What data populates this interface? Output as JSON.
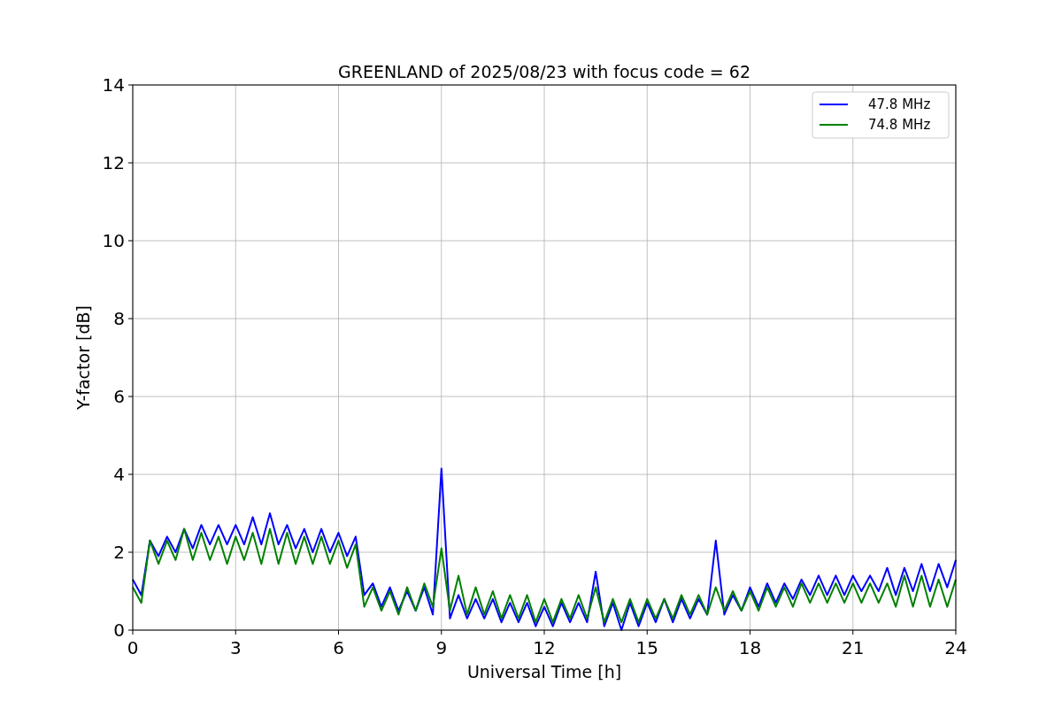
{
  "figure": {
    "chart_data": {
      "type": "line",
      "title": "GREENLAND of 2025/08/23 with focus code = 62",
      "xlabel": "Universal Time [h]",
      "ylabel": "Y-factor [dB]",
      "x": [
        0,
        0.25,
        0.5,
        0.75,
        1,
        1.25,
        1.5,
        1.75,
        2,
        2.25,
        2.5,
        2.75,
        3,
        3.25,
        3.5,
        3.75,
        4,
        4.25,
        4.5,
        4.75,
        5,
        5.25,
        5.5,
        5.75,
        6,
        6.25,
        6.5,
        6.75,
        7,
        7.25,
        7.5,
        7.75,
        8,
        8.25,
        8.5,
        8.75,
        9,
        9.25,
        9.5,
        9.75,
        10,
        10.25,
        10.5,
        10.75,
        11,
        11.25,
        11.5,
        11.75,
        12,
        12.25,
        12.5,
        12.75,
        13,
        13.25,
        13.5,
        13.75,
        14,
        14.25,
        14.5,
        14.75,
        15,
        15.25,
        15.5,
        15.75,
        16,
        16.25,
        16.5,
        16.75,
        17,
        17.25,
        17.5,
        17.75,
        18,
        18.25,
        18.5,
        18.75,
        19,
        19.25,
        19.5,
        19.75,
        20,
        20.25,
        20.5,
        20.75,
        21,
        21.25,
        21.5,
        21.75,
        22,
        22.25,
        22.5,
        22.75,
        23,
        23.25,
        23.5,
        23.75,
        24
      ],
      "series": [
        {
          "name": "47.8 MHz",
          "color": "#0000ff",
          "values": [
            1.3,
            0.9,
            2.3,
            1.9,
            2.4,
            2.0,
            2.6,
            2.1,
            2.7,
            2.2,
            2.7,
            2.2,
            2.7,
            2.2,
            2.9,
            2.2,
            3.0,
            2.2,
            2.7,
            2.1,
            2.6,
            2.0,
            2.6,
            2.0,
            2.5,
            1.9,
            2.4,
            0.9,
            1.2,
            0.6,
            1.1,
            0.5,
            1.0,
            0.5,
            1.1,
            0.4,
            4.15,
            0.3,
            0.9,
            0.3,
            0.8,
            0.3,
            0.8,
            0.2,
            0.7,
            0.2,
            0.7,
            0.1,
            0.6,
            0.1,
            0.7,
            0.2,
            0.7,
            0.2,
            1.5,
            0.1,
            0.7,
            0.0,
            0.7,
            0.1,
            0.7,
            0.2,
            0.8,
            0.2,
            0.8,
            0.3,
            0.8,
            0.4,
            2.3,
            0.4,
            0.9,
            0.5,
            1.1,
            0.6,
            1.2,
            0.7,
            1.2,
            0.8,
            1.3,
            0.9,
            1.4,
            0.9,
            1.4,
            0.9,
            1.4,
            1.0,
            1.4,
            1.0,
            1.6,
            0.9,
            1.6,
            1.0,
            1.7,
            1.0,
            1.7,
            1.1,
            1.8
          ]
        },
        {
          "name": "74.8 MHz",
          "color": "#008000",
          "values": [
            1.1,
            0.7,
            2.3,
            1.7,
            2.3,
            1.8,
            2.6,
            1.8,
            2.5,
            1.8,
            2.4,
            1.7,
            2.4,
            1.8,
            2.5,
            1.7,
            2.6,
            1.7,
            2.5,
            1.7,
            2.4,
            1.7,
            2.4,
            1.7,
            2.3,
            1.6,
            2.2,
            0.6,
            1.1,
            0.5,
            1.0,
            0.4,
            1.1,
            0.5,
            1.2,
            0.6,
            2.1,
            0.5,
            1.4,
            0.4,
            1.1,
            0.4,
            1.0,
            0.3,
            0.9,
            0.3,
            0.9,
            0.2,
            0.8,
            0.2,
            0.8,
            0.3,
            0.9,
            0.3,
            1.1,
            0.2,
            0.8,
            0.2,
            0.8,
            0.2,
            0.8,
            0.3,
            0.8,
            0.3,
            0.9,
            0.4,
            0.9,
            0.4,
            1.1,
            0.5,
            1.0,
            0.5,
            1.0,
            0.5,
            1.1,
            0.6,
            1.1,
            0.6,
            1.2,
            0.7,
            1.2,
            0.7,
            1.2,
            0.7,
            1.2,
            0.7,
            1.2,
            0.7,
            1.2,
            0.6,
            1.4,
            0.6,
            1.4,
            0.6,
            1.3,
            0.6,
            1.3
          ]
        }
      ],
      "xlim": [
        0,
        24
      ],
      "ylim": [
        0,
        14
      ],
      "xticks": [
        0,
        3,
        6,
        9,
        12,
        15,
        18,
        21,
        24
      ],
      "yticks": [
        0,
        2,
        4,
        6,
        8,
        10,
        12,
        14
      ],
      "grid": true,
      "legend": true
    }
  }
}
